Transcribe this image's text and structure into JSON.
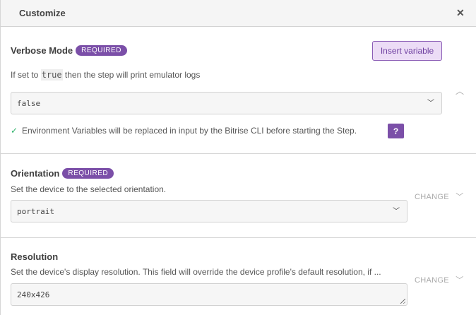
{
  "header": {
    "title": "Customize",
    "close_icon": "close-icon"
  },
  "verbose": {
    "label": "Verbose Mode",
    "badge": "REQUIRED",
    "insert_label": "Insert variable",
    "desc_before": "If set to ",
    "desc_code": "true",
    "desc_after": " then the step will print emulator logs",
    "value": "false",
    "note": "Environment Variables will be replaced in input by the Bitrise CLI before starting the Step.",
    "help_label": "?"
  },
  "orientation": {
    "label": "Orientation",
    "badge": "REQUIRED",
    "desc": "Set the device to the selected orientation.",
    "value": "portrait",
    "change_label": "CHANGE"
  },
  "resolution": {
    "label": "Resolution",
    "desc": "Set the device's display resolution. This field will override the device profile's default resolution, if ...",
    "value": "240x426",
    "change_label": "CHANGE"
  },
  "colors": {
    "accent": "#7b4fa8",
    "check": "#2fb36b"
  }
}
